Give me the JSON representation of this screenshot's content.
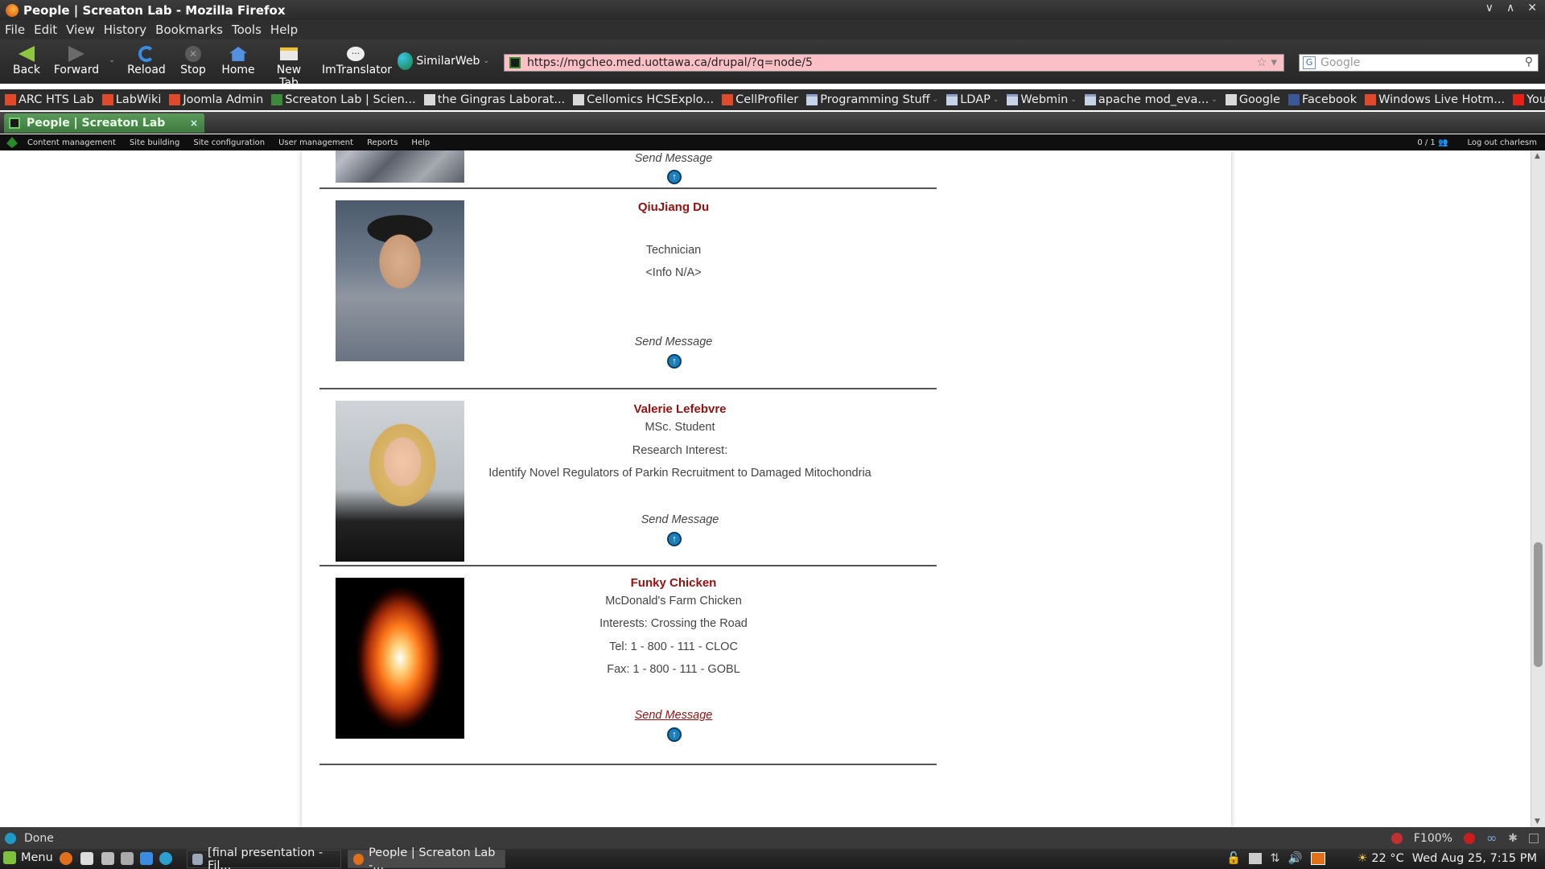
{
  "window": {
    "title": "People | Screaton Lab - Mozilla Firefox",
    "controls": [
      "∨",
      "∧",
      "✕"
    ]
  },
  "menubar": [
    "File",
    "Edit",
    "View",
    "History",
    "Bookmarks",
    "Tools",
    "Help"
  ],
  "nav": {
    "back": "Back",
    "forward": "Forward",
    "reload": "Reload",
    "stop": "Stop",
    "home": "Home",
    "new_tab": "New Tab",
    "imtranslator": "ImTranslator",
    "similarweb": "SimilarWeb",
    "url": "https://mgcheo.med.uottawa.ca/drupal/?q=node/5",
    "search_placeholder": "Google"
  },
  "bookmarks": [
    {
      "label": "ARC HTS Lab",
      "icon": "red"
    },
    {
      "label": "LabWiki",
      "icon": "red"
    },
    {
      "label": "Joomla Admin",
      "icon": "red"
    },
    {
      "label": "Screaton Lab | Scien...",
      "icon": "green"
    },
    {
      "label": "the Gingras Laborat...",
      "icon": ""
    },
    {
      "label": "Cellomics HCSExplo...",
      "icon": ""
    },
    {
      "label": "CellProfiler",
      "icon": "red"
    },
    {
      "label": "Programming Stuff",
      "icon": "folder",
      "chev": true
    },
    {
      "label": "LDAP",
      "icon": "folder",
      "chev": true
    },
    {
      "label": "Webmin",
      "icon": "folder",
      "chev": true
    },
    {
      "label": "apache mod_eva...",
      "icon": "folder",
      "chev": true
    },
    {
      "label": "Google",
      "icon": ""
    },
    {
      "label": "Facebook",
      "icon": "blue"
    },
    {
      "label": "Windows Live Hotm...",
      "icon": "red"
    },
    {
      "label": "YouTube",
      "icon": "yt"
    }
  ],
  "tab": {
    "label": "People | Screaton Lab",
    "close": "×"
  },
  "admin": {
    "items": [
      "Content management",
      "Site building",
      "Site configuration",
      "User management",
      "Reports",
      "Help"
    ],
    "users_online": "0 / 1",
    "logout": "Log out charlesm"
  },
  "people": [
    {
      "name": "",
      "lines": [],
      "send": "Send Message",
      "up": "↑"
    },
    {
      "name": "QiuJiang Du",
      "lines": [
        "Technician",
        "<Info N/A>"
      ],
      "send": "Send Message",
      "up": "↑"
    },
    {
      "name": "Valerie Lefebvre",
      "lines": [
        "MSc. Student",
        "Research Interest:",
        "Identify Novel Regulators of Parkin Recruitment to Damaged Mitochondria"
      ],
      "send": "Send Message",
      "up": "↑"
    },
    {
      "name": "Funky Chicken",
      "lines": [
        "McDonald's Farm Chicken",
        "Interests: Crossing the Road",
        "Tel: 1 - 800 - 111 - CLOC",
        "Fax: 1 - 800 - 111 - GOBL"
      ],
      "send": "Send Message",
      "up": "↑"
    }
  ],
  "status": {
    "text": "Done",
    "zoom": "F100%",
    "abp": "ABP"
  },
  "taskbar": {
    "menu": "Menu",
    "tasks": [
      "[final presentation - Fil...",
      "People | Screaton Lab -..."
    ],
    "weather": "22 °C",
    "clock": "Wed Aug 25,  7:15 PM"
  }
}
